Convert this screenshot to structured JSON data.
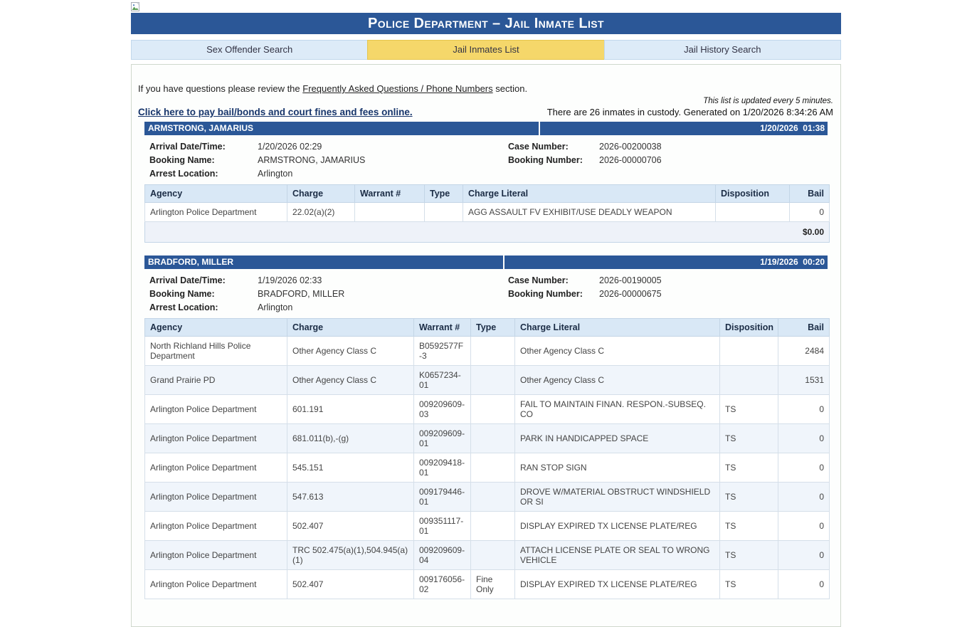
{
  "colors": {
    "header_blue": "#2b5797",
    "tab_active_yellow": "#f5d76a",
    "tab_inactive_blue": "#ddebf8",
    "table_header_blue": "#d9e8f6",
    "row_alt_blue": "#f0f5fb"
  },
  "header": {
    "title": "Police Department – Jail Inmate List"
  },
  "tabs": [
    {
      "label": "Sex Offender Search",
      "active": false
    },
    {
      "label": "Jail Inmates List",
      "active": true
    },
    {
      "label": "Jail History Search",
      "active": false
    }
  ],
  "intro": {
    "faq_prefix": "If you have questions please review the ",
    "faq_link": "Frequently Asked Questions / Phone Numbers",
    "faq_suffix": " section.",
    "updated_note": "This list is updated every 5 minutes.",
    "pay_link": "Click here to pay bail/bonds and court fines and fees online.",
    "custody_line": "There are 26 inmates in custody. Generated on 1/20/2026 8:34:26 AM"
  },
  "record_labels": {
    "arrival": "Arrival Date/Time:",
    "booking_name": "Booking Name:",
    "arrest_location": "Arrest Location:",
    "case_number": "Case Number:",
    "booking_number": "Booking Number:"
  },
  "table_headers": [
    "Agency",
    "Charge",
    "Warrant #",
    "Type",
    "Charge Literal",
    "Disposition",
    "Bail"
  ],
  "inmates": [
    {
      "name": "ARMSTRONG, JAMARIUS",
      "header_date": "1/20/2026  01:38",
      "arrival": "1/20/2026 02:29",
      "booking_name": "ARMSTRONG, JAMARIUS",
      "arrest_location": "Arlington",
      "case_number": "2026-00200038",
      "booking_number": "2026-00000706",
      "charges": [
        {
          "agency": "Arlington Police Department",
          "charge": "22.02(a)(2)",
          "warrant": "",
          "type": "",
          "literal": "AGG ASSAULT FV EXHIBIT/USE DEADLY WEAPON",
          "disposition": "",
          "bail": "0"
        }
      ],
      "total": "$0.00"
    },
    {
      "name": "BRADFORD, MILLER",
      "header_date": "1/19/2026  00:20",
      "arrival": "1/19/2026 02:33",
      "booking_name": "BRADFORD, MILLER",
      "arrest_location": "Arlington",
      "case_number": "2026-00190005",
      "booking_number": "2026-00000675",
      "charges": [
        {
          "agency": "North Richland Hills Police Department",
          "charge": "Other Agency Class C",
          "warrant": "B0592577F-3",
          "type": "",
          "literal": "Other Agency Class C",
          "disposition": "",
          "bail": "2484"
        },
        {
          "agency": "Grand Prairie PD",
          "charge": "Other Agency Class C",
          "warrant": "K0657234-01",
          "type": "",
          "literal": "Other Agency Class C",
          "disposition": "",
          "bail": "1531"
        },
        {
          "agency": "Arlington Police Department",
          "charge": "601.191",
          "warrant": "009209609-03",
          "type": "",
          "literal": "FAIL TO MAINTAIN FINAN. RESPON.-SUBSEQ. CO",
          "disposition": "TS",
          "bail": "0"
        },
        {
          "agency": "Arlington Police Department",
          "charge": "681.011(b),-(g)",
          "warrant": "009209609-01",
          "type": "",
          "literal": "PARK IN HANDICAPPED SPACE",
          "disposition": "TS",
          "bail": "0"
        },
        {
          "agency": "Arlington Police Department",
          "charge": "545.151",
          "warrant": "009209418-01",
          "type": "",
          "literal": "RAN STOP SIGN",
          "disposition": "TS",
          "bail": "0"
        },
        {
          "agency": "Arlington Police Department",
          "charge": "547.613",
          "warrant": "009179446-01",
          "type": "",
          "literal": "DROVE W/MATERIAL OBSTRUCT WINDSHIELD OR SI",
          "disposition": "TS",
          "bail": "0"
        },
        {
          "agency": "Arlington Police Department",
          "charge": "502.407",
          "warrant": "009351117-01",
          "type": "",
          "literal": "DISPLAY EXPIRED TX LICENSE PLATE/REG",
          "disposition": "TS",
          "bail": "0"
        },
        {
          "agency": "Arlington Police Department",
          "charge": "TRC 502.475(a)(1),504.945(a)(1)",
          "warrant": "009209609-04",
          "type": "",
          "literal": "ATTACH LICENSE PLATE OR SEAL TO WRONG VEHICLE",
          "disposition": "TS",
          "bail": "0"
        },
        {
          "agency": "Arlington Police Department",
          "charge": "502.407",
          "warrant": "009176056-02",
          "type": "Fine Only",
          "literal": "DISPLAY EXPIRED TX LICENSE PLATE/REG",
          "disposition": "TS",
          "bail": "0"
        }
      ]
    }
  ]
}
